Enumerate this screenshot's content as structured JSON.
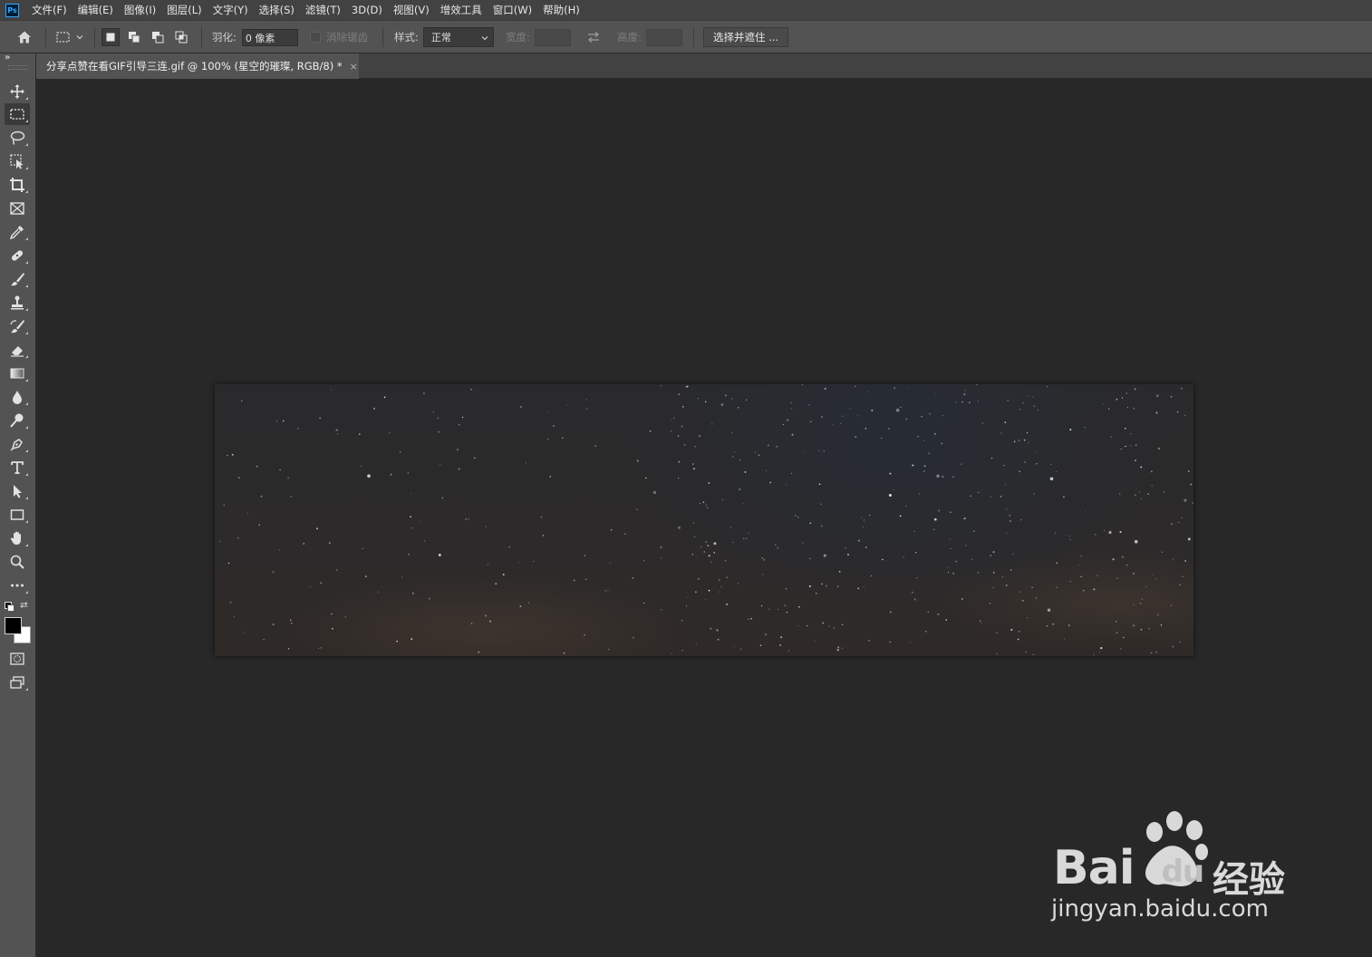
{
  "app": {
    "logo_text": "Ps"
  },
  "menu": [
    {
      "label": "文件(F)"
    },
    {
      "label": "编辑(E)"
    },
    {
      "label": "图像(I)"
    },
    {
      "label": "图层(L)"
    },
    {
      "label": "文字(Y)"
    },
    {
      "label": "选择(S)"
    },
    {
      "label": "滤镜(T)"
    },
    {
      "label": "3D(D)"
    },
    {
      "label": "视图(V)"
    },
    {
      "label": "增效工具"
    },
    {
      "label": "窗口(W)"
    },
    {
      "label": "帮助(H)"
    }
  ],
  "options": {
    "feather_label": "羽化:",
    "feather_value": "0 像素",
    "antialias_label": "消除锯齿",
    "style_label": "样式:",
    "style_value": "正常",
    "width_label": "宽度:",
    "height_label": "高度:",
    "select_mask_button": "选择并遮住 ..."
  },
  "tab": {
    "title": "分享点赞在看GIF引导三连.gif @ 100% (星空的璀璨, RGB/8) *",
    "close": "×"
  },
  "watermark": {
    "brand": "Bai",
    "brand_du": "du",
    "product": "经验",
    "url": "jingyan.baidu.com"
  },
  "colors": {
    "menubar": "#424242",
    "optionsbar": "#535353",
    "canvas_bg": "#282828",
    "foreground_color": "#000000",
    "background_color": "#ffffff"
  },
  "tools": [
    "move-tool-icon",
    "rectangular-marquee-icon",
    "lasso-icon",
    "object-selection-icon",
    "crop-icon",
    "frame-icon",
    "eyedropper-icon",
    "healing-brush-icon",
    "brush-icon",
    "clone-stamp-icon",
    "history-brush-icon",
    "eraser-icon",
    "gradient-icon",
    "blur-icon",
    "dodge-icon",
    "pen-icon",
    "type-icon",
    "path-selection-icon",
    "rectangle-icon",
    "hand-icon",
    "zoom-icon",
    "more-tools-icon"
  ]
}
